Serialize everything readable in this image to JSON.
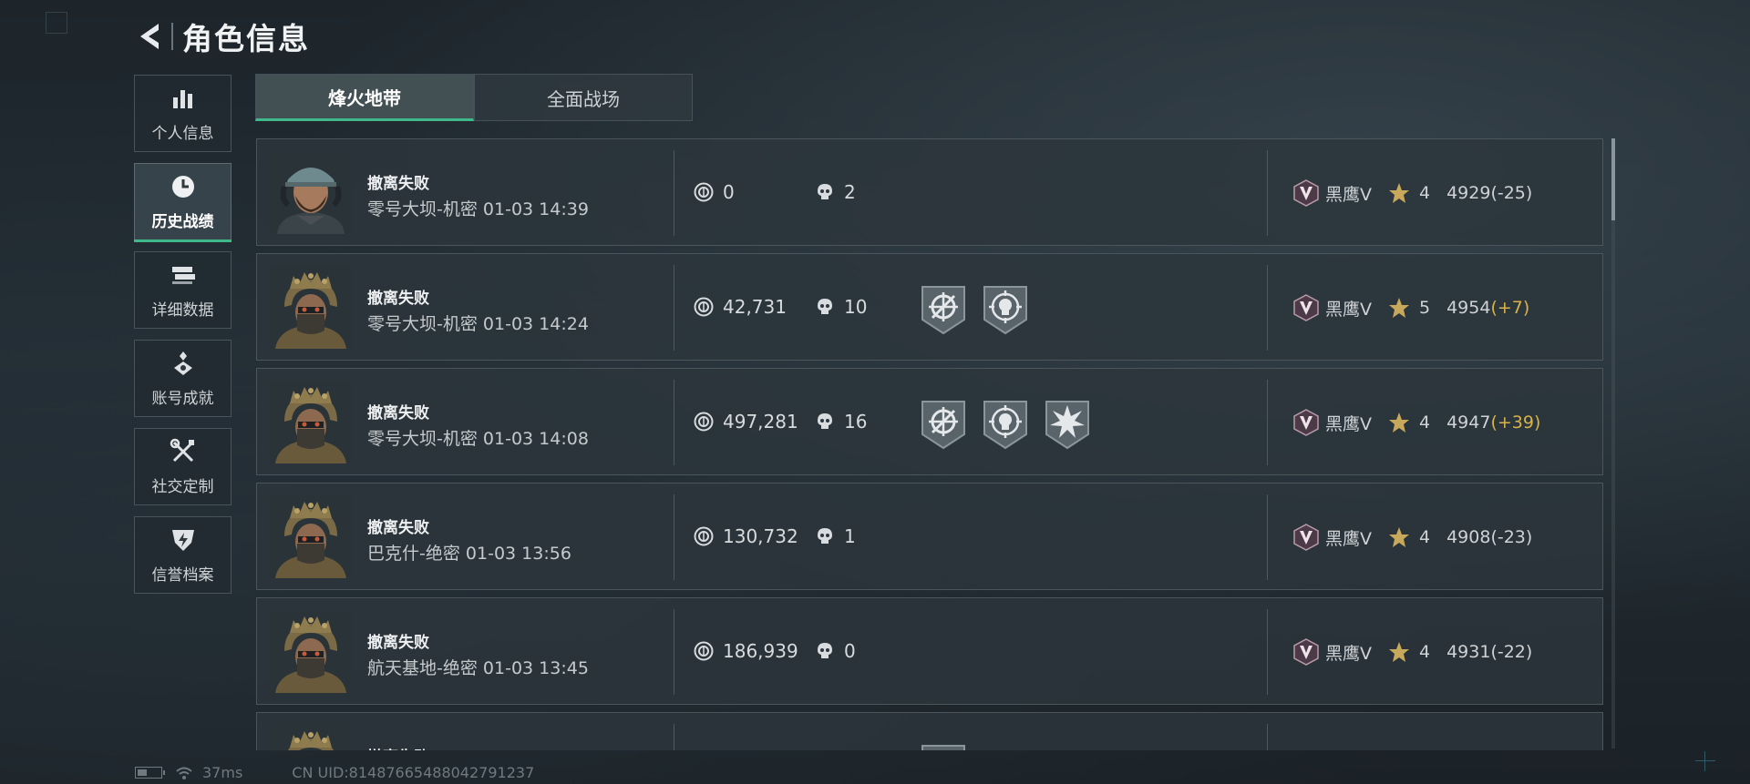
{
  "header": {
    "title": "角色信息",
    "back_icon": "back-arrow-icon"
  },
  "sidebar": {
    "items": [
      {
        "label": "个人信息",
        "icon": "bar-chart-icon",
        "active": false
      },
      {
        "label": "历史战绩",
        "icon": "clock-icon",
        "active": true
      },
      {
        "label": "详细数据",
        "icon": "stacked-cards-icon",
        "active": false
      },
      {
        "label": "账号成就",
        "icon": "achievement-icon",
        "active": false
      },
      {
        "label": "社交定制",
        "icon": "tools-icon",
        "active": false
      },
      {
        "label": "信誉档案",
        "icon": "shield-lightning-icon",
        "active": false
      }
    ]
  },
  "tabs": [
    {
      "label": "烽火地带",
      "active": true
    },
    {
      "label": "全面战场",
      "active": false
    }
  ],
  "colors": {
    "accent": "#3fb98a",
    "positive_delta": "#d9b24a",
    "star": "#c8a85a"
  },
  "matches": [
    {
      "result": "撤离失败",
      "map": "零号大坝-机密",
      "time": "01-03 14:39",
      "value": "0",
      "kills": "2",
      "badges": [],
      "rank": "黑鹰V",
      "stars": "4",
      "score": "4929",
      "delta": "(-25)",
      "avatar": "capped-soldier"
    },
    {
      "result": "撤离失败",
      "map": "零号大坝-机密",
      "time": "01-03 14:24",
      "value": "42,731",
      "kills": "10",
      "badges": [
        "crosshair-badge-icon",
        "skull-target-badge-icon"
      ],
      "rank": "黑鹰V",
      "stars": "5",
      "score": "4954",
      "delta": "(+7)",
      "avatar": "helmet-soldier"
    },
    {
      "result": "撤离失败",
      "map": "零号大坝-机密",
      "time": "01-03 14:08",
      "value": "497,281",
      "kills": "16",
      "badges": [
        "crosshair-badge-icon",
        "skull-target-badge-icon",
        "burst-badge-icon"
      ],
      "rank": "黑鹰V",
      "stars": "4",
      "score": "4947",
      "delta": "(+39)",
      "avatar": "helmet-soldier"
    },
    {
      "result": "撤离失败",
      "map": "巴克什-绝密",
      "time": "01-03 13:56",
      "value": "130,732",
      "kills": "1",
      "badges": [],
      "rank": "黑鹰V",
      "stars": "4",
      "score": "4908",
      "delta": "(-23)",
      "avatar": "helmet-soldier"
    },
    {
      "result": "撤离失败",
      "map": "航天基地-绝密",
      "time": "01-03 13:45",
      "value": "186,939",
      "kills": "0",
      "badges": [],
      "rank": "黑鹰V",
      "stars": "4",
      "score": "4931",
      "delta": "(-22)",
      "avatar": "helmet-soldier"
    },
    {
      "result": "撤离失败",
      "map": "",
      "time": "",
      "value": "",
      "kills": "",
      "badges": [
        "crosshair-badge-icon"
      ],
      "rank": "",
      "stars": "",
      "score": "",
      "delta": "",
      "avatar": "helmet-soldier",
      "partial": true
    }
  ],
  "status": {
    "latency": "37ms",
    "uid": "CN UID:8148766548804279123​7"
  }
}
